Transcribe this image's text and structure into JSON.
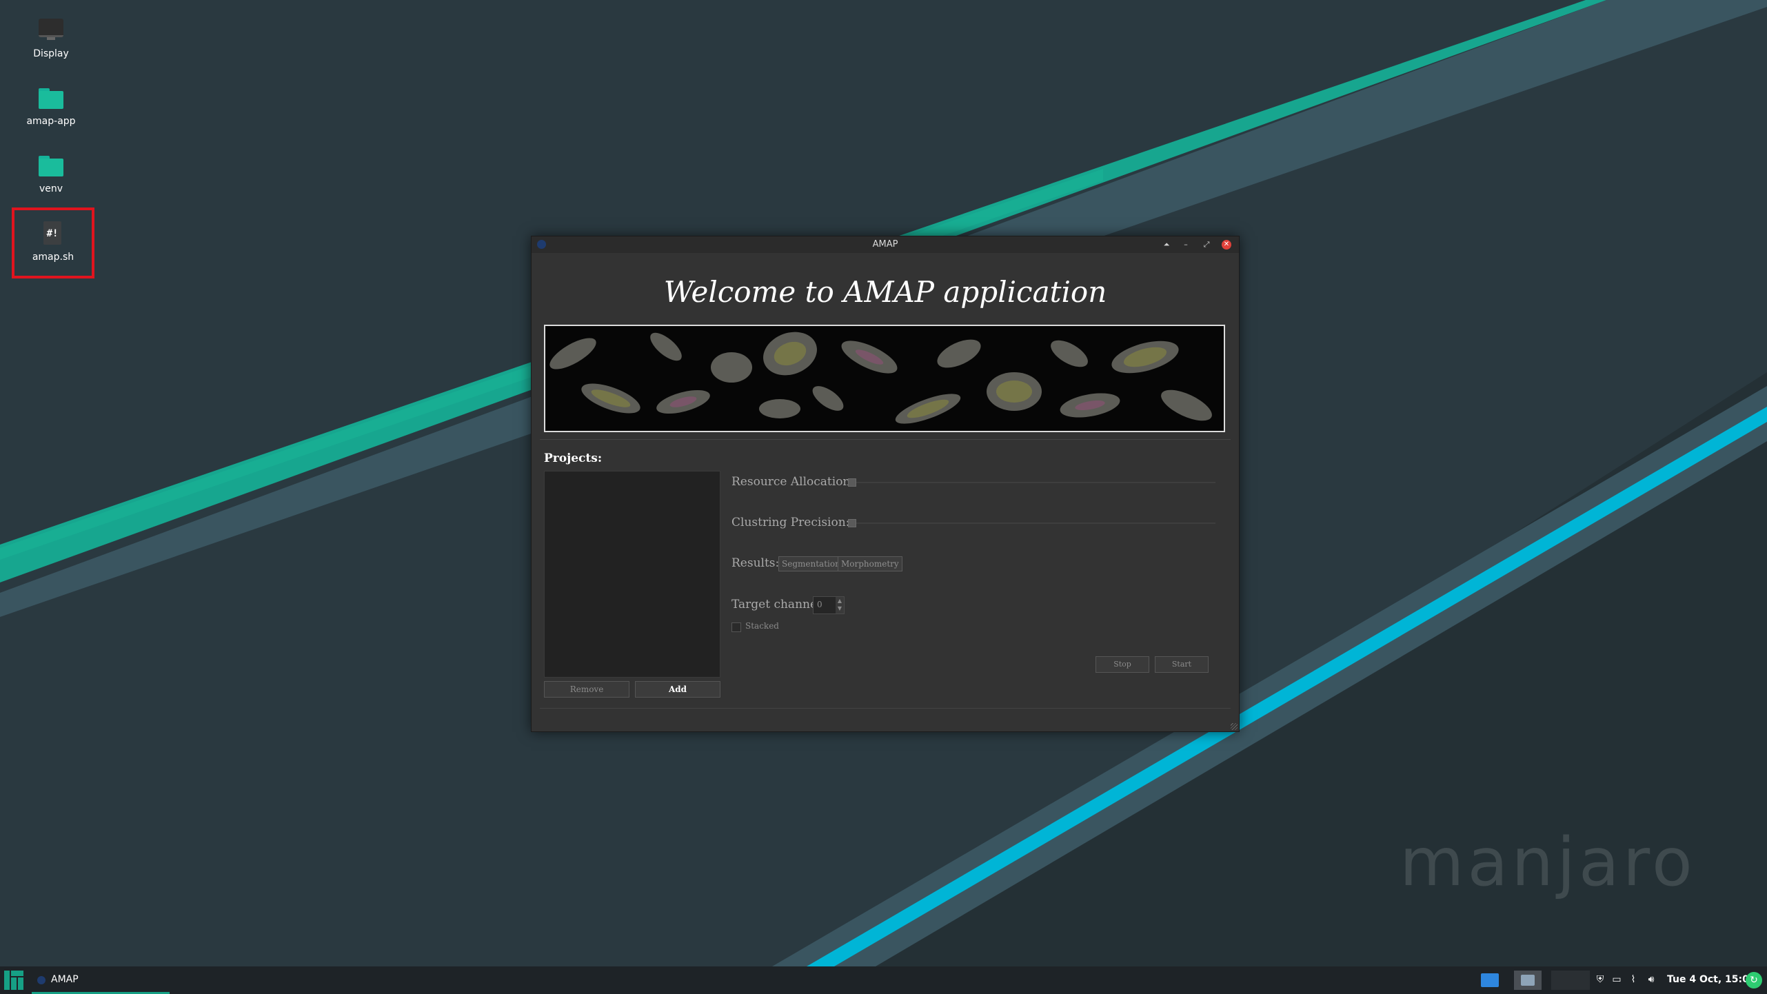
{
  "desktop": {
    "icons": [
      {
        "label": "Display",
        "icon": "monitor-icon"
      },
      {
        "label": "amap-app",
        "icon": "folder-icon"
      },
      {
        "label": "venv",
        "icon": "folder-icon"
      },
      {
        "label": "amap.sh",
        "icon": "shell-script-icon",
        "glyph": "#!",
        "selected": true
      }
    ],
    "watermark": "manjaro",
    "colors": {
      "background": "#2a3940",
      "accent_green": "#1abc9c",
      "accent_cyan": "#00b5d6",
      "selection": "#e0141e"
    }
  },
  "window": {
    "title": "AMAP",
    "controls": {
      "keep_above": "⏶",
      "minimize": "–",
      "maximize": "⤢",
      "close": "✕"
    },
    "welcome": "Welcome to AMAP application",
    "projects": {
      "label": "Projects:",
      "remove_label": "Remove",
      "add_label": "Add"
    },
    "settings": {
      "resource_allocation_label": "Resource Allocation:",
      "clustering_precision_label": "Clustring Precision:",
      "results_label": "Results:",
      "segmentation_label": "Segmentation",
      "morphometry_label": "Morphometry",
      "target_channel_label": "Target channel",
      "target_channel_value": "0",
      "stacked_label": "Stacked"
    },
    "actions": {
      "stop_label": "Stop",
      "start_label": "Start"
    }
  },
  "taskbar": {
    "task_label": "AMAP",
    "clock": "Tue 4 Oct, 15:04",
    "tray_icons": [
      "shield-icon",
      "window-icon",
      "paperclip-icon",
      "volume-icon"
    ],
    "update_glyph": "↻"
  }
}
